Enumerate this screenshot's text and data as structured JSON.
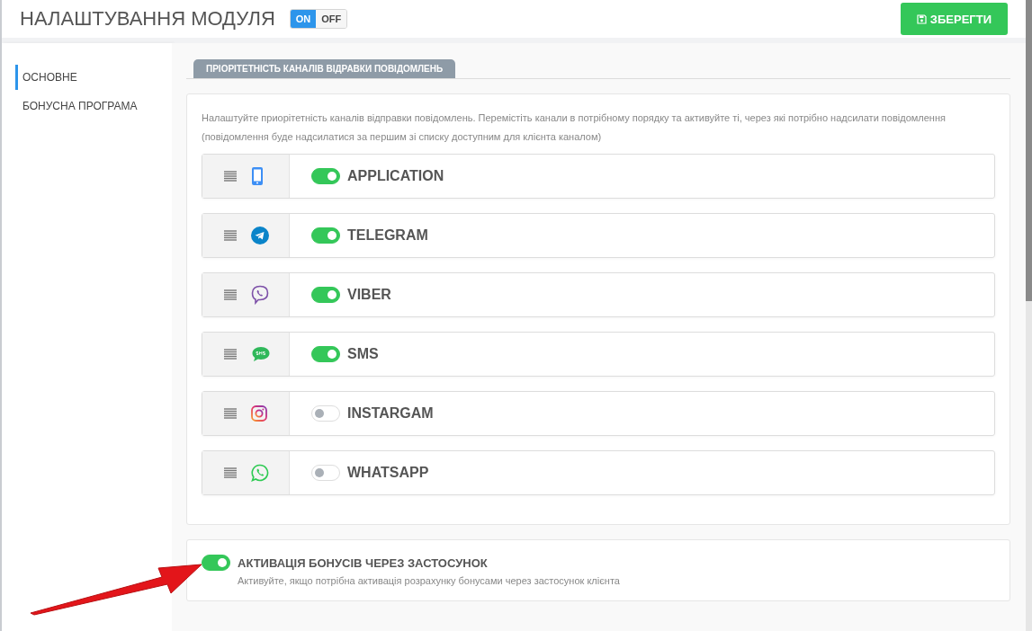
{
  "header": {
    "title": "НАЛАШТУВАННЯ МОДУЛЯ",
    "module_switch": [
      {
        "label": "ON",
        "selected": true
      },
      {
        "label": "OFF",
        "selected": false
      }
    ],
    "save_button": "ЗБЕРЕГТИ"
  },
  "sidebar": {
    "items": [
      {
        "label": "ОСНОВНЕ",
        "selected": true
      },
      {
        "label": "БОНУСНА ПРОГРАМА",
        "selected": false
      }
    ]
  },
  "tabs": [
    {
      "label": "ПРІОРІТЕТНІСТЬ КАНАЛІВ ВІДРАВКИ ПОВІДОМЛЕНЬ",
      "selected": true
    }
  ],
  "channels_card": {
    "description": "Налаштуйте приорітетність каналів відправки повідомлень. Перемістіть канали в потрібному порядку та активуйте ті, через які потрібно надсилати повідомлення (повідомлення буде надсилатися за першим зі списку доступним для клієнта каналом)",
    "channels": [
      {
        "kind": "phone",
        "name": "APPLICATION",
        "on": true
      },
      {
        "kind": "telegram",
        "name": "TELEGRAM",
        "on": true
      },
      {
        "kind": "viber",
        "name": "VIBER",
        "on": true
      },
      {
        "kind": "sms",
        "name": "SMS",
        "on": true
      },
      {
        "kind": "instagram",
        "name": "INSTARGAM",
        "on": false
      },
      {
        "kind": "whatsapp",
        "name": "WHATSAPP",
        "on": false
      }
    ]
  },
  "bonus_card": {
    "title": "АКТИВАЦІЯ БОНУСІВ ЧЕРЕЗ ЗАСТОСУНОК",
    "description": "Активуйте, якщо потрібна активація розрахунку бонусами через застосунок клієнта",
    "on": true
  }
}
